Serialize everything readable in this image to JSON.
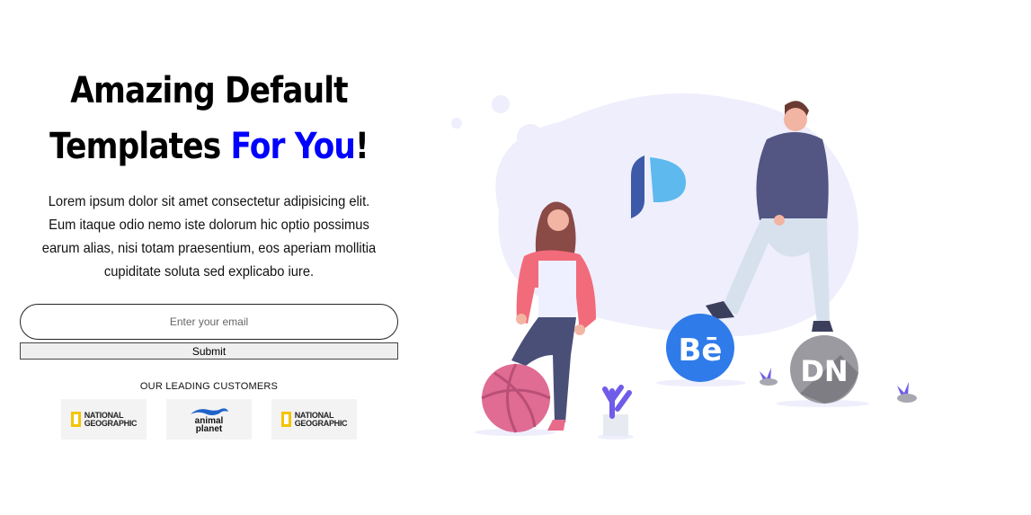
{
  "hero": {
    "headline_line1": "Amazing Default",
    "headline_line2_start": "Templates ",
    "headline_accent": "For You",
    "headline_end": "!",
    "description": "Lorem ipsum dolor sit amet consectetur adipisicing elit. Eum itaque odio nemo iste dolorum hic optio possimus earum alias, nisi totam praesentium, eos aperiam mollitia cupiditate soluta sed explicabo iure.",
    "accent_color": "#0000ff"
  },
  "form": {
    "email_placeholder": "Enter your email",
    "submit_label": "Submit"
  },
  "customers": {
    "title": "OUR LEADING CUSTOMERS",
    "logos": [
      {
        "icon": "national-geographic-logo",
        "line1": "NATIONAL",
        "line2": "GEOGRAPHIC"
      },
      {
        "icon": "animal-planet-logo",
        "line1": "animal",
        "line2": "planet"
      },
      {
        "icon": "national-geographic-logo",
        "line1": "NATIONAL",
        "line2": "GEOGRAPHIC"
      }
    ]
  },
  "illustration": {
    "behance_label": "Bē",
    "dribbble_label": "DN",
    "blob_color": "#eeeefc"
  }
}
